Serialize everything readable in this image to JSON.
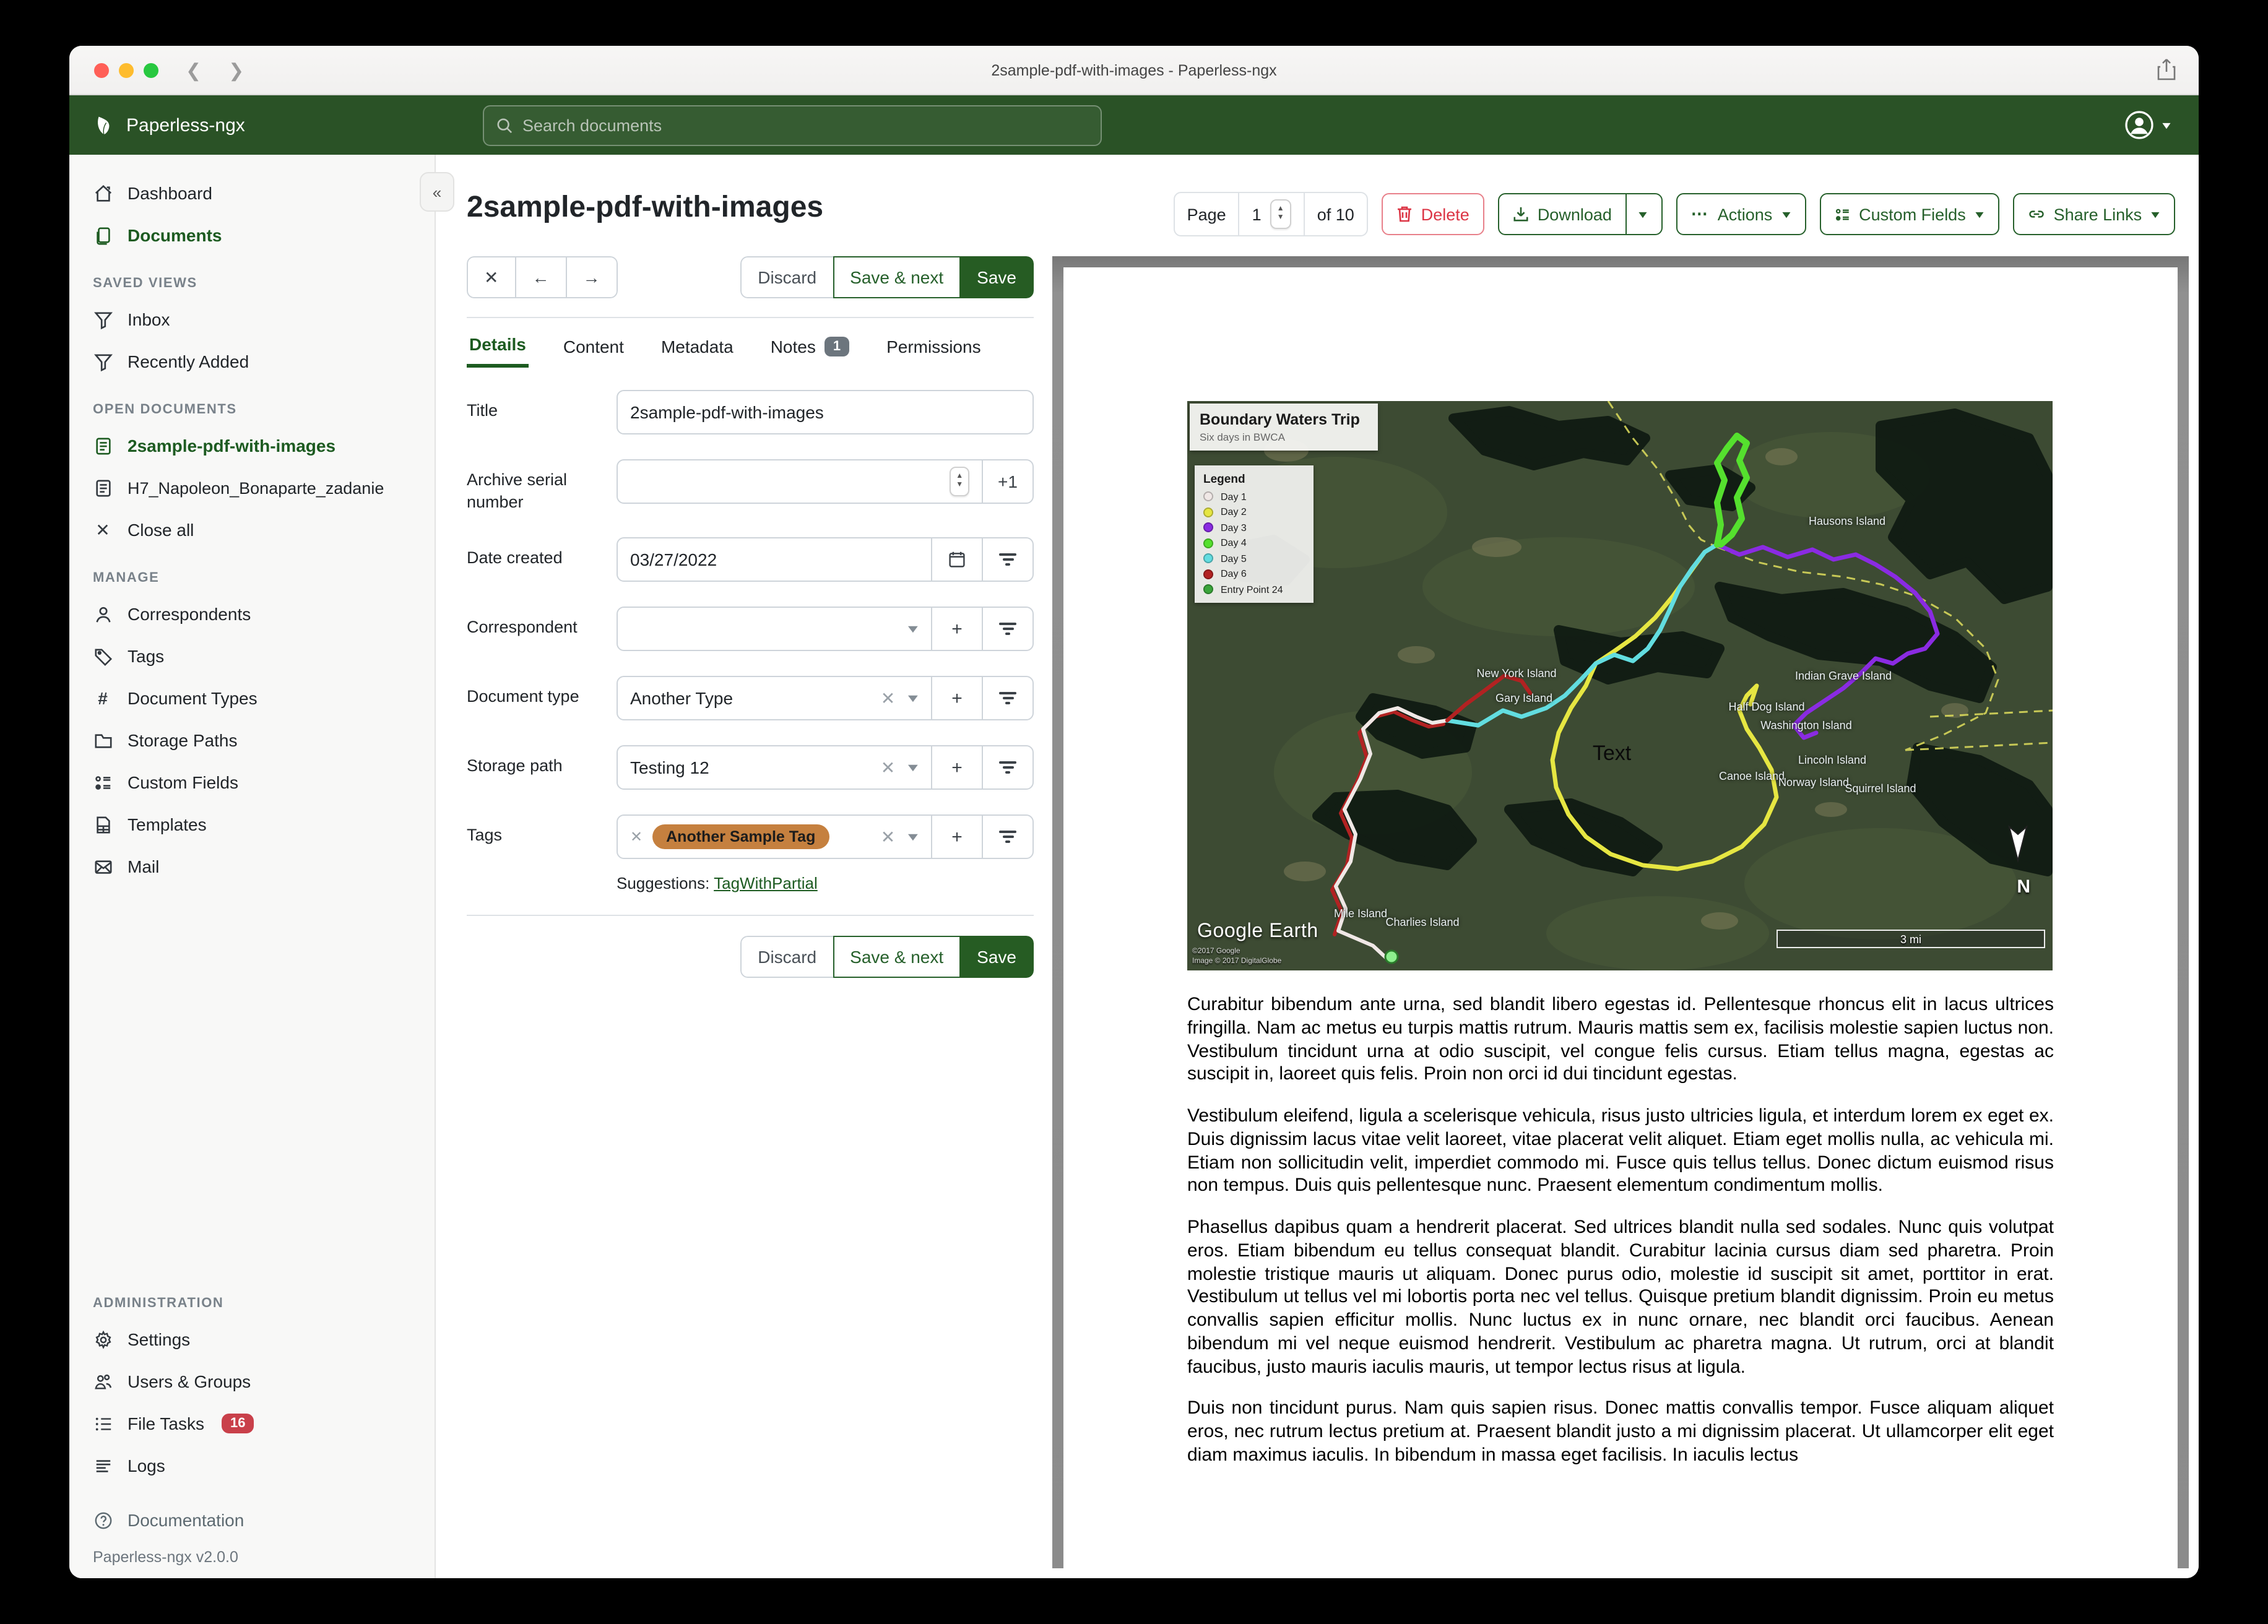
{
  "window": {
    "title": "2sample-pdf-with-images - Paperless-ngx",
    "traffic_colors": [
      "#ff5f57",
      "#febc2e",
      "#28c840"
    ]
  },
  "header": {
    "brand": "Paperless-ngx",
    "search_placeholder": "Search documents"
  },
  "sidebar": {
    "dashboard": "Dashboard",
    "documents": "Documents",
    "sections": [
      {
        "title": "SAVED VIEWS",
        "items": [
          {
            "label": "Inbox"
          },
          {
            "label": "Recently Added"
          }
        ]
      },
      {
        "title": "OPEN DOCUMENTS",
        "items": [
          {
            "label": "2sample-pdf-with-images"
          },
          {
            "label": "H7_Napoleon_Bonaparte_zadanie"
          },
          {
            "label": "Close all"
          }
        ]
      },
      {
        "title": "MANAGE",
        "items": [
          {
            "label": "Correspondents"
          },
          {
            "label": "Tags"
          },
          {
            "label": "Document Types"
          },
          {
            "label": "Storage Paths"
          },
          {
            "label": "Custom Fields"
          },
          {
            "label": "Templates"
          },
          {
            "label": "Mail"
          }
        ]
      },
      {
        "title": "ADMINISTRATION",
        "items": [
          {
            "label": "Settings"
          },
          {
            "label": "Users & Groups"
          },
          {
            "label": "File Tasks"
          },
          {
            "label": "Logs"
          }
        ]
      }
    ],
    "file_tasks_badge": "16",
    "documentation": "Documentation",
    "version": "Paperless-ngx v2.0.0"
  },
  "toolbar": {
    "page_label": "Page",
    "page_value": "1",
    "page_of": "of 10",
    "delete": "Delete",
    "download": "Download",
    "actions": "Actions",
    "custom_fields": "Custom Fields",
    "share_links": "Share Links",
    "accent_green": "#26602b",
    "danger_red": "#dc3545"
  },
  "doc": {
    "title": "2sample-pdf-with-images",
    "discard": "Discard",
    "save_next": "Save & next",
    "save": "Save"
  },
  "tabs": {
    "details": "Details",
    "content": "Content",
    "metadata": "Metadata",
    "notes": "Notes",
    "notes_badge": "1",
    "permissions": "Permissions"
  },
  "form": {
    "title_label": "Title",
    "title_value": "2sample-pdf-with-images",
    "asn_label": "Archive serial number",
    "asn_value": "",
    "asn_add": "+1",
    "date_label": "Date created",
    "date_value": "03/27/2022",
    "correspondent_label": "Correspondent",
    "correspondent_value": "",
    "doctype_label": "Document type",
    "doctype_value": "Another Type",
    "storage_label": "Storage path",
    "storage_value": "Testing 12",
    "tags_label": "Tags",
    "tag_pill": "Another Sample Tag",
    "tag_color": "#c5803f",
    "suggestions_label": "Suggestions:",
    "suggestion_link": "TagWithPartial"
  },
  "preview": {
    "map": {
      "title": "Boundary Waters Trip",
      "subtitle": "Six days in BWCA",
      "legend_title": "Legend",
      "legend": [
        {
          "label": "Day 1",
          "color": "#f0e8e6"
        },
        {
          "label": "Day 2",
          "color": "#e6e642"
        },
        {
          "label": "Day 3",
          "color": "#8a2be2"
        },
        {
          "label": "Day 4",
          "color": "#55e02e"
        },
        {
          "label": "Day 5",
          "color": "#62dde0"
        },
        {
          "label": "Day 6",
          "color": "#b22222"
        },
        {
          "label": "Entry Point 24",
          "color": "#3aa53a"
        }
      ],
      "islands": [
        "New York Island",
        "Gary Island",
        "Hausons Island",
        "Indian Grave Island",
        "Half Dog Island",
        "Washington Island",
        "Lincoln Island",
        "Canoe Island",
        "Norway Island",
        "Squirrel Island",
        "Mile Island",
        "Charlies Island"
      ],
      "text_label": "Text",
      "logo": "Google Earth",
      "attribution1": "©2017 Google",
      "attribution2": "Image © 2017 DigitalGlobe",
      "compass": "N",
      "scale": "3 mi"
    },
    "paragraphs": [
      "Curabitur bibendum ante urna, sed blandit libero egestas id. Pellentesque rhoncus elit in lacus ultrices fringilla. Nam ac metus eu turpis mattis rutrum. Mauris mattis sem ex, facilisis molestie sapien luctus non. Vestibulum tincidunt urna at odio suscipit, vel congue felis cursus. Etiam tellus magna, egestas ac suscipit in, laoreet quis felis. Proin non orci id dui tincidunt egestas.",
      "Vestibulum eleifend, ligula a scelerisque vehicula, risus justo ultricies ligula, et interdum lorem ex eget ex. Duis dignissim lacus vitae velit laoreet, vitae placerat velit aliquet. Etiam eget mollis nulla, ac vehicula mi. Etiam non sollicitudin velit, imperdiet commodo mi. Fusce quis tellus tellus. Donec dictum euismod risus non tempus. Duis quis pellentesque nunc. Praesent elementum condimentum mollis.",
      "Phasellus dapibus quam a hendrerit placerat. Sed ultrices blandit nulla sed sodales. Nunc quis volutpat eros. Etiam bibendum eu tellus consequat blandit. Curabitur lacinia cursus diam sed pharetra. Proin molestie tristique mauris ut aliquam. Donec purus odio, molestie id suscipit sit amet, porttitor in erat. Vestibulum ut tellus vel mi lobortis porta nec vel tellus. Quisque pretium blandit dignissim. Proin eu metus convallis sapien efficitur mollis. Nunc luctus ex in nunc ornare, nec blandit orci faucibus. Aenean bibendum mi vel neque euismod hendrerit. Vestibulum ac pharetra magna. Ut rutrum, orci at blandit faucibus, justo mauris iaculis mauris, ut tempor lectus risus at ligula.",
      "Duis non tincidunt purus. Nam quis sapien risus. Donec mattis convallis tempor. Fusce aliquam aliquet eros, nec rutrum lectus pretium at. Praesent blandit justo a mi dignissim placerat. Ut ullamcorper elit eget diam maximus iaculis. In bibendum in massa eget facilisis. In iaculis lectus"
    ]
  }
}
